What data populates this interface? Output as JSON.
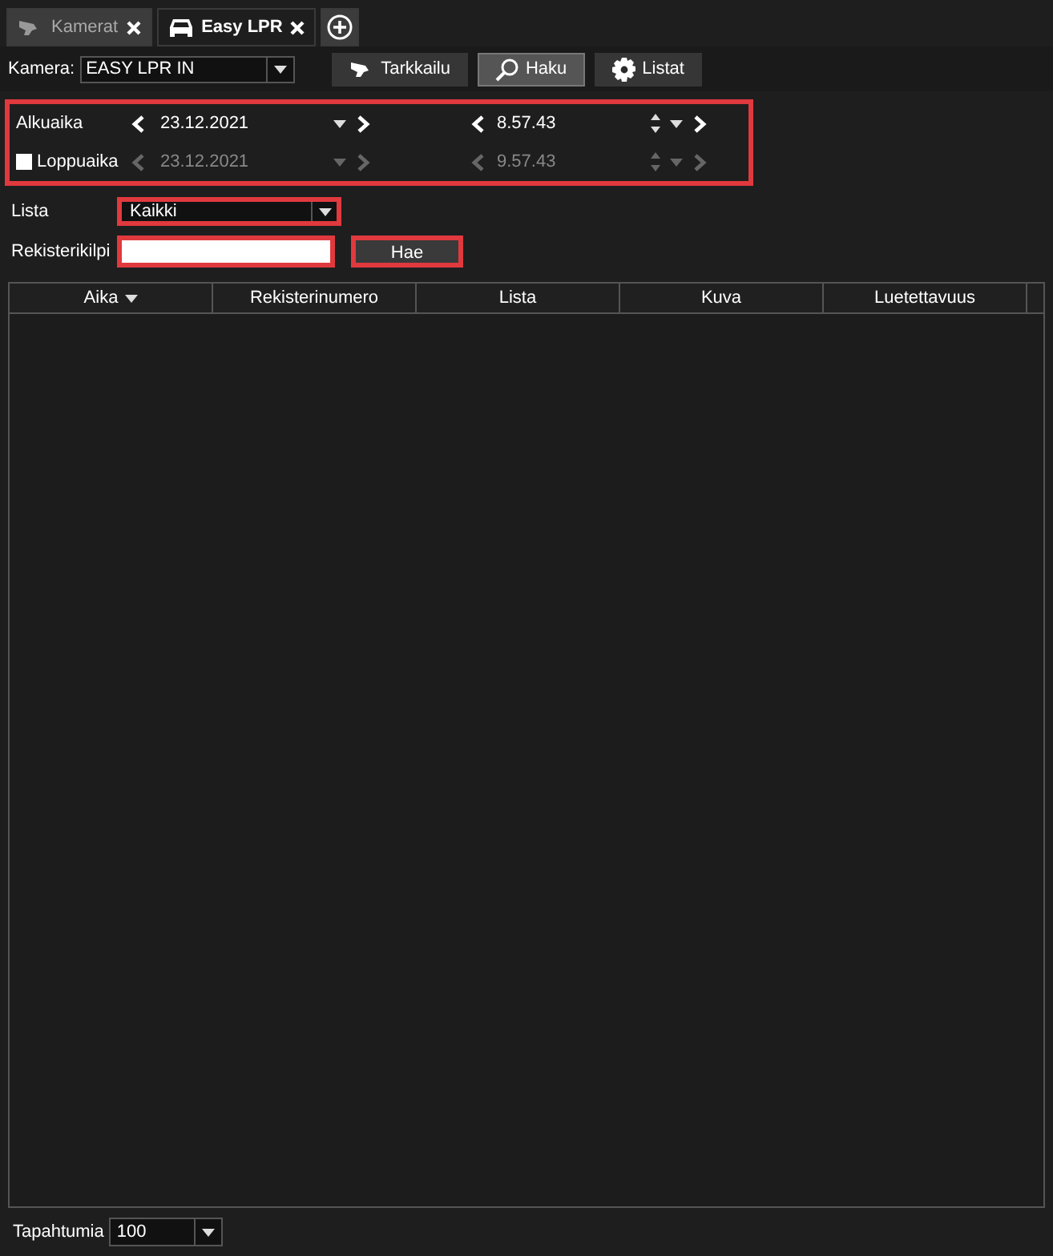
{
  "tabs": [
    {
      "label": "Kamerat",
      "kind": "camera",
      "selected": false
    },
    {
      "label": "Easy LPR",
      "kind": "car",
      "selected": true
    }
  ],
  "toolbar": {
    "camera_label": "Kamera:",
    "camera_value": "EASY LPR IN",
    "buttons": [
      {
        "label": "Tarkkailu",
        "kind": "camera",
        "selected": false
      },
      {
        "label": "Haku",
        "kind": "search",
        "selected": true
      },
      {
        "label": "Listat",
        "kind": "gear",
        "selected": false
      }
    ]
  },
  "time_range": [
    {
      "label": "Alkuaika",
      "kind": "plain",
      "date": "23.12.2021",
      "time": "8.57.43",
      "disabled": false
    },
    {
      "label": "Loppuaika",
      "kind": "checkbox",
      "checked": false,
      "date": "23.12.2021",
      "time": "9.57.43",
      "disabled": true
    }
  ],
  "filters": {
    "list_label": "Lista",
    "list_value": "Kaikki",
    "plate_label": "Rekisterikilpi",
    "search_button": "Hae"
  },
  "table": {
    "columns": [
      {
        "label": "Aika",
        "sorted": true
      },
      {
        "label": "Rekisterinumero",
        "sorted": false
      },
      {
        "label": "Lista",
        "sorted": false
      },
      {
        "label": "Kuva",
        "sorted": false
      },
      {
        "label": "Luetettavuus",
        "sorted": false
      }
    ]
  },
  "footer": {
    "label": "Tapahtumia",
    "value": "100"
  }
}
